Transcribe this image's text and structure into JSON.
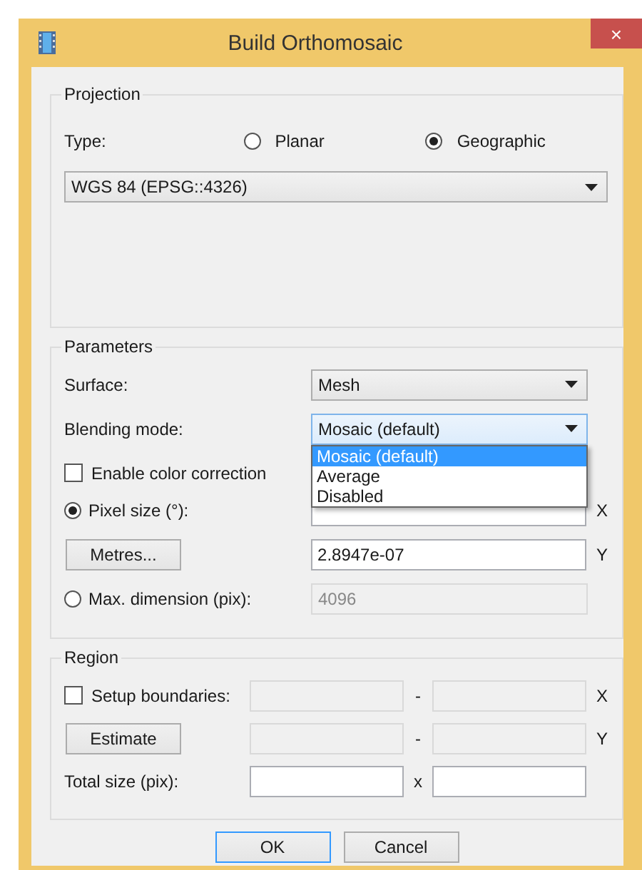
{
  "window": {
    "title": "Build Orthomosaic",
    "close": "×"
  },
  "projection": {
    "title": "Projection",
    "type_label": "Type:",
    "types": [
      {
        "label": "Planar",
        "selected": false
      },
      {
        "label": "Geographic",
        "selected": true
      }
    ],
    "crs": "WGS 84 (EPSG::4326)"
  },
  "parameters": {
    "title": "Parameters",
    "surface_label": "Surface:",
    "surface": "Mesh",
    "blending_label": "Blending mode:",
    "blending": "Mosaic (default)",
    "blending_options": [
      {
        "label": "Mosaic (default)",
        "selected": true
      },
      {
        "label": "Average",
        "selected": false
      },
      {
        "label": "Disabled",
        "selected": false
      }
    ],
    "color_correction": {
      "label": "Enable color correction",
      "checked": false
    },
    "size_modes": [
      {
        "label": "Pixel size (°):",
        "selected": true
      },
      {
        "label": "Max. dimension (pix):",
        "selected": false
      }
    ],
    "x_label": "X",
    "y_label": "Y",
    "pixel_y": "2.8947e-07",
    "metres_button": "Metres...",
    "max_dimension": "4096"
  },
  "region": {
    "title": "Region",
    "setup_boundaries": {
      "label": "Setup boundaries:",
      "checked": false
    },
    "dash": "-",
    "x_label": "X",
    "y_label": "Y",
    "estimate_button": "Estimate",
    "total_label": "Total size (pix):",
    "times": "x"
  },
  "buttons": [
    "OK",
    "Cancel"
  ]
}
